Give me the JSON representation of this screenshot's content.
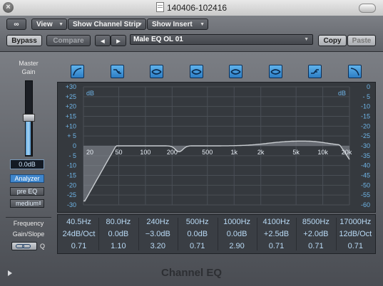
{
  "window": {
    "title": "140406-102416",
    "close_glyph": "×"
  },
  "toolbar": {
    "link_glyph": "∞",
    "view_label": "View",
    "channel_strip_label": "Show Channel Strip",
    "show_insert_label": "Show Insert",
    "bypass_label": "Bypass",
    "compare_label": "Compare",
    "prev_glyph": "◀",
    "next_glyph": "▶",
    "preset_name": "Male EQ OL 01",
    "copy_label": "Copy",
    "paste_label": "Paste"
  },
  "left_panel": {
    "master_label": "Master",
    "gain_label": "Gain",
    "gain_value": "0.0dB",
    "gain_level": 0.5,
    "analyzer_label": "Analyzer",
    "pre_eq_label": "pre EQ",
    "medium_label": "medium",
    "frequency_label": "Frequency",
    "gain_slope_label": "Gain/Slope",
    "q_label": "Q"
  },
  "bands": [
    {
      "icon": "high-pass-icon"
    },
    {
      "icon": "low-shelf-icon"
    },
    {
      "icon": "peak-icon"
    },
    {
      "icon": "peak-icon"
    },
    {
      "icon": "peak-icon"
    },
    {
      "icon": "peak-icon"
    },
    {
      "icon": "high-shelf-icon"
    },
    {
      "icon": "low-pass-icon"
    }
  ],
  "graph": {
    "left_unit": "dB",
    "right_unit": "dB",
    "left_ticks": [
      "+30",
      "+25",
      "+20",
      "+15",
      "+10",
      "+ 5",
      "0",
      "- 5",
      "-10",
      "-15",
      "-20",
      "-25",
      "-30"
    ],
    "right_ticks": [
      "0",
      "- 5",
      "-10",
      "-15",
      "-20",
      "-25",
      "-30",
      "-35",
      "-40",
      "-45",
      "-50",
      "-55",
      "-60"
    ],
    "freq_labels": [
      "20",
      "50",
      "100",
      "200",
      "500",
      "1k",
      "2k",
      "5k",
      "10k",
      "20k"
    ],
    "curve_color": "#c8ccd0",
    "grid_color": "#4a4f56",
    "axis_color": "#6fb5e8"
  },
  "params": {
    "frequency": [
      "40.5Hz",
      "80.0Hz",
      "240Hz",
      "500Hz",
      "1000Hz",
      "4100Hz",
      "8500Hz",
      "17000Hz"
    ],
    "gain_slope": [
      "24dB/Oct",
      "0.0dB",
      "−3.0dB",
      "0.0dB",
      "0.0dB",
      "+2.5dB",
      "+2.0dB",
      "12dB/Oct"
    ],
    "q": [
      "0.71",
      "1.10",
      "3.20",
      "0.71",
      "2.90",
      "0.71",
      "0.71",
      "0.71"
    ]
  },
  "footer": {
    "title": "Channel EQ"
  },
  "colors": {
    "accent": "#3f86cc",
    "value_text": "#b9daf5"
  }
}
